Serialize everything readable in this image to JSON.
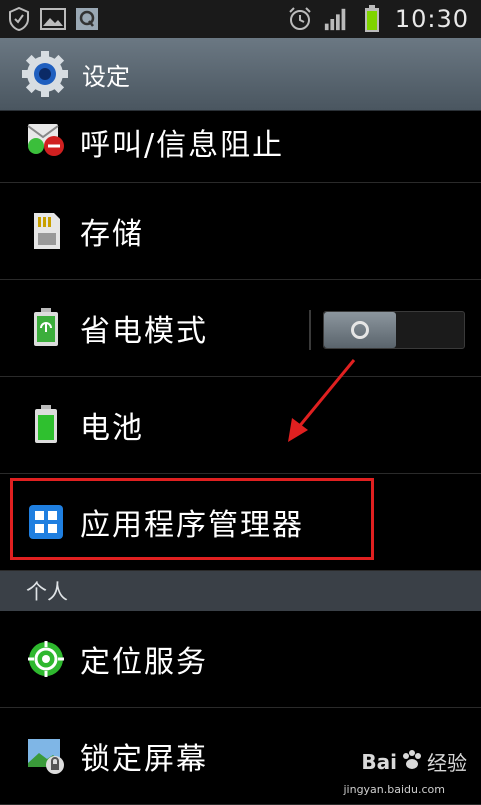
{
  "statusbar": {
    "time": "10:30",
    "left_icons": [
      "shield-icon",
      "image-icon",
      "q-app-icon"
    ],
    "right_icons": [
      "alarm-icon",
      "signal-icon",
      "battery-icon"
    ]
  },
  "titlebar": {
    "title": "设定"
  },
  "items": [
    {
      "label": "呼叫/信息阻止",
      "icon": "call-block-icon"
    },
    {
      "label": "存储",
      "icon": "sd-card-icon"
    },
    {
      "label": "省电模式",
      "icon": "power-saving-icon",
      "toggle_on": false
    },
    {
      "label": "电池",
      "icon": "battery-icon"
    },
    {
      "label": "应用程序管理器",
      "icon": "app-manager-icon"
    }
  ],
  "section": {
    "label": "个人"
  },
  "personal_items": [
    {
      "label": "定位服务",
      "icon": "location-icon"
    },
    {
      "label": "锁定屏幕",
      "icon": "lock-screen-icon"
    }
  ],
  "watermark": {
    "brand": "Bai",
    "brand2": "百",
    "sub": "经验",
    "url": "jingyan.baidu.com"
  },
  "colors": {
    "highlight": "#e02020",
    "titlebar": "#5a6670",
    "section_header": "#3a4047"
  }
}
